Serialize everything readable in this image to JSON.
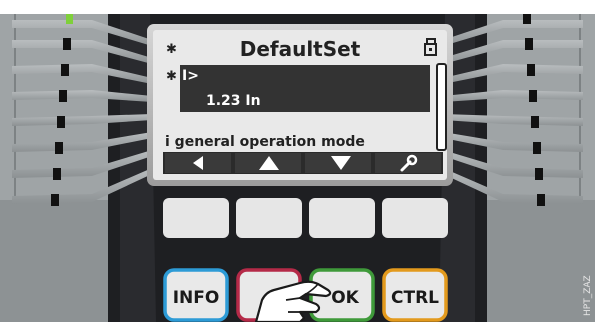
{
  "lcd": {
    "title": "DefaultSet",
    "param_name": "I>",
    "param_value": "1.23 In",
    "info_line": "i general operation mode",
    "marker_symbol": "✱",
    "title_icon": "lock-icon",
    "softkeys": [
      {
        "icon": "arrow-left-icon"
      },
      {
        "icon": "arrow-up-icon"
      },
      {
        "icon": "arrow-down-icon"
      },
      {
        "icon": "wrench-icon"
      }
    ]
  },
  "keys": {
    "info": "INFO",
    "ok": "OK",
    "ctrl": "CTRL"
  },
  "colors": {
    "info_border": "#2d9bd6",
    "c_border": "#b52a48",
    "ok_border": "#3f9a3a",
    "ctrl_border": "#e39a1d",
    "lcd_background": "#e9e9e9",
    "highlight": "#333333",
    "device_body": "#1e1f22",
    "led_green": "#7fd03a"
  },
  "watermark": "HPT_ZAZ",
  "hand_icon": "pointing-hand-icon"
}
